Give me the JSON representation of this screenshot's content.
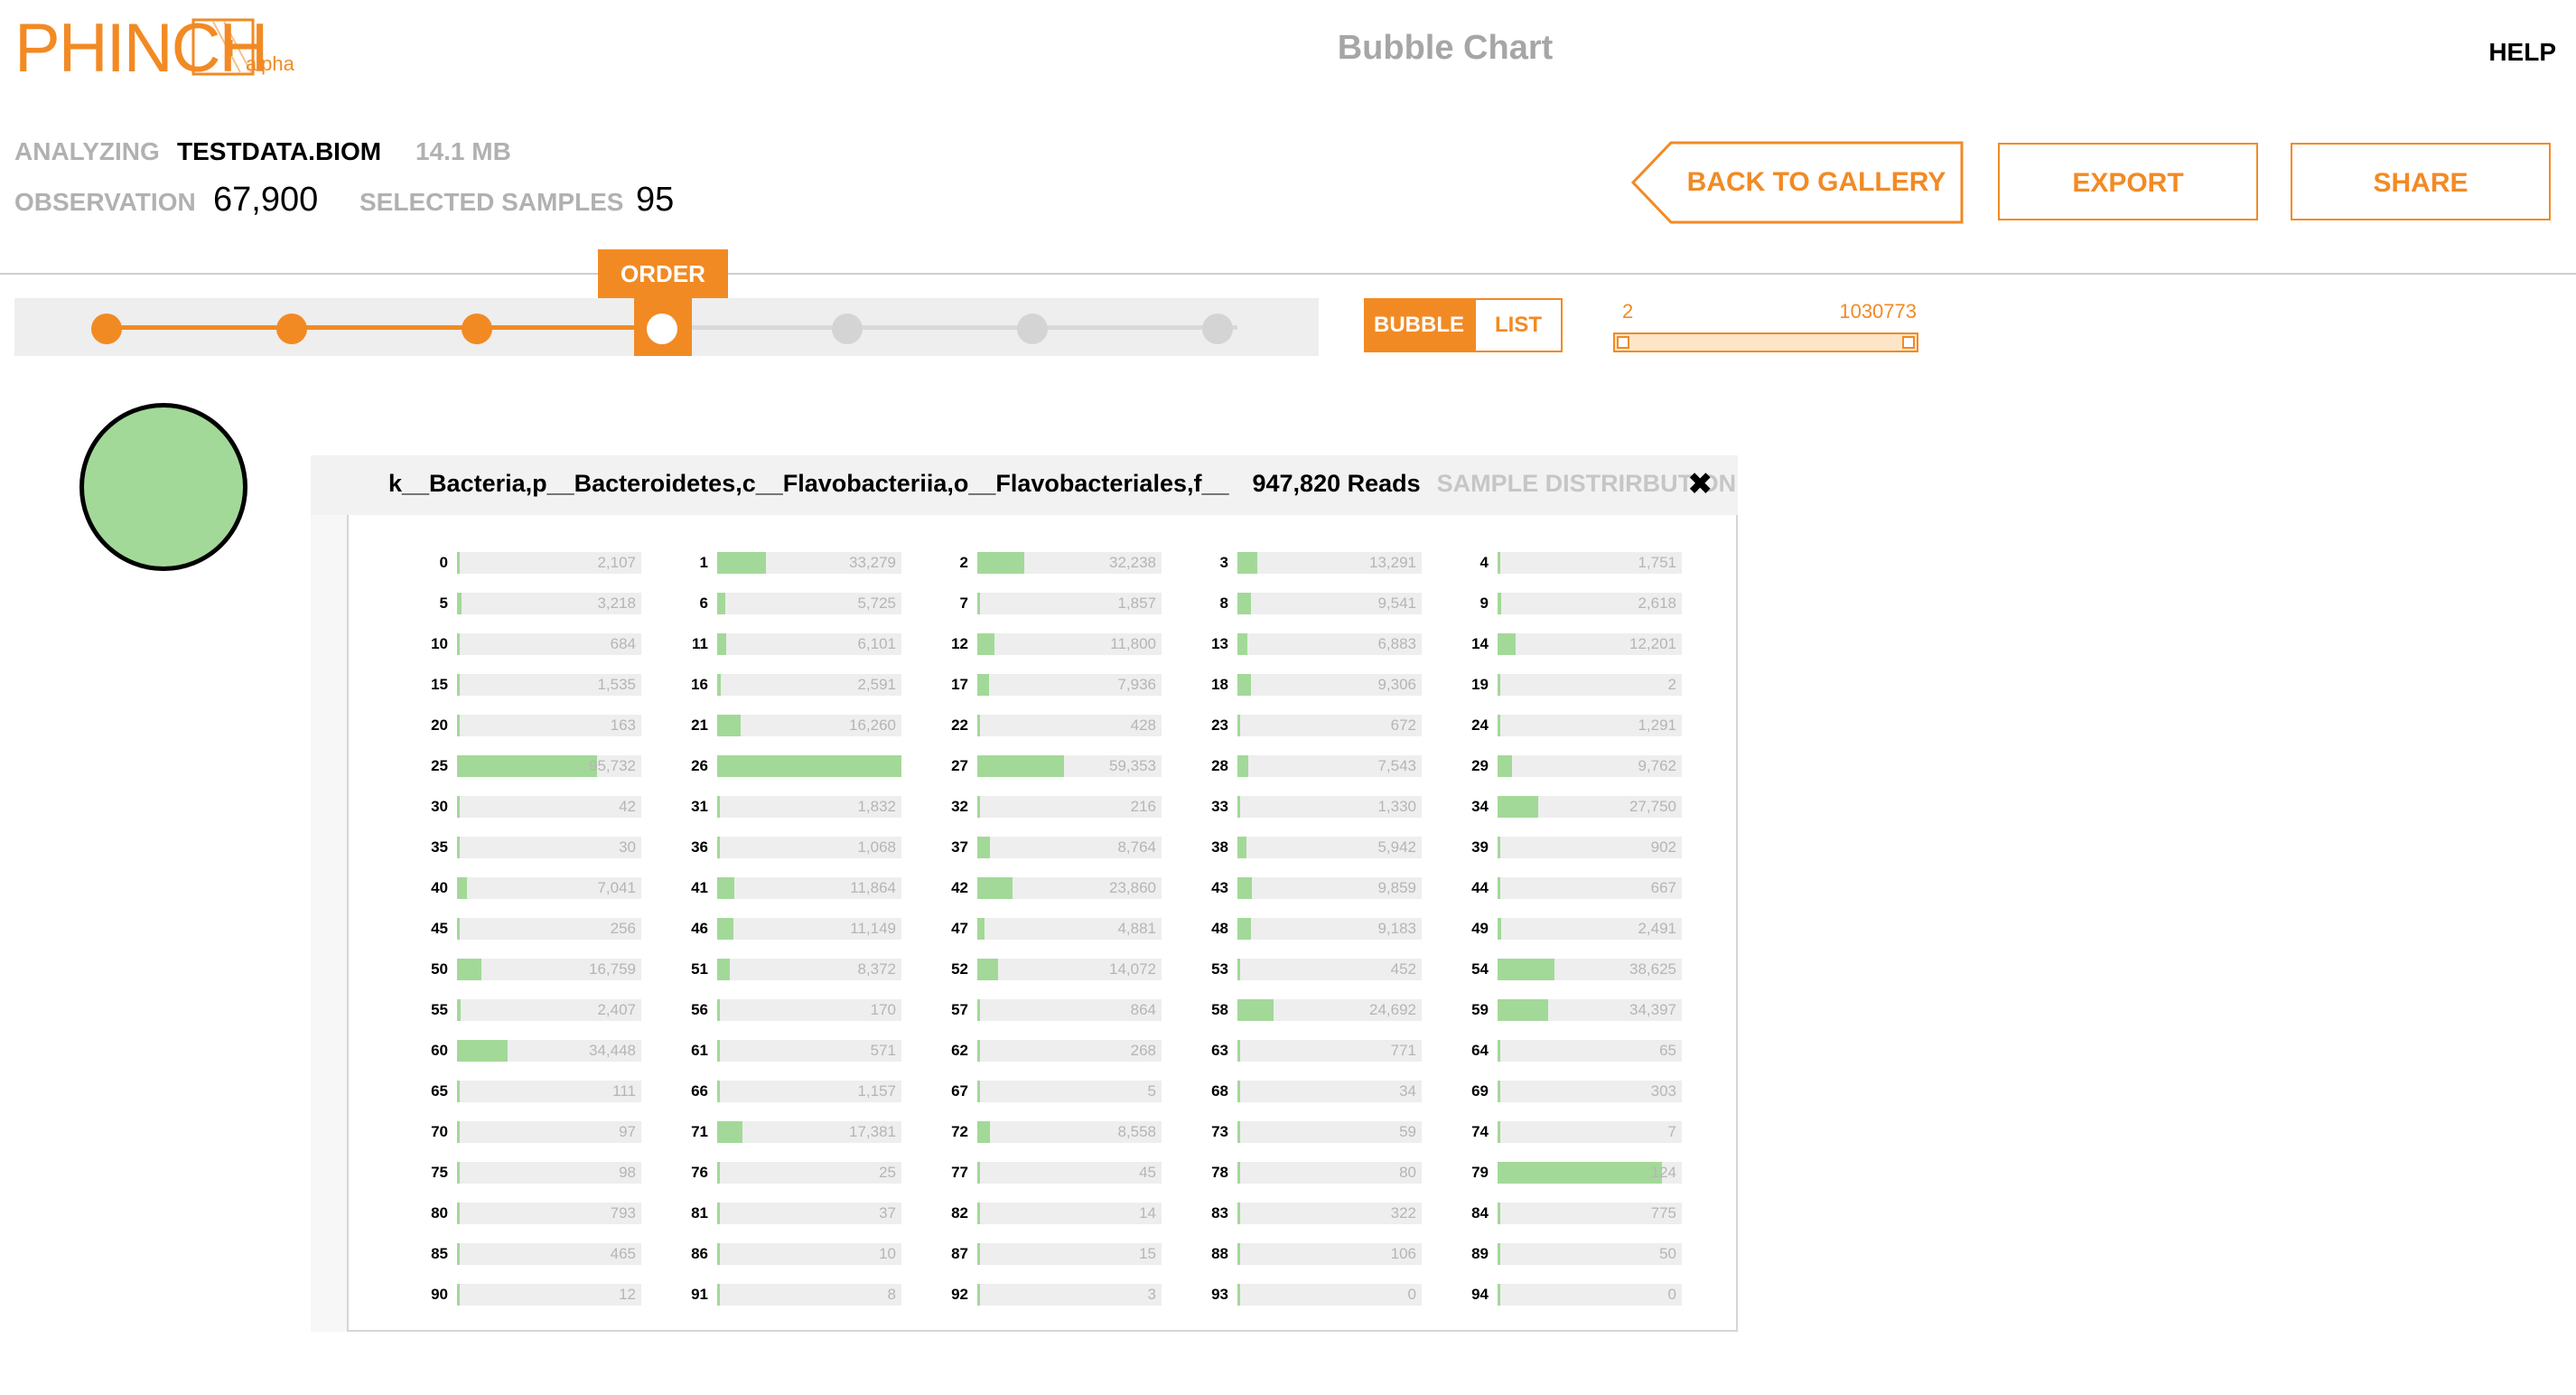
{
  "header": {
    "logo_text": "PHINCH",
    "logo_alpha": "alpha",
    "page_title": "Bubble Chart",
    "help": "HELP"
  },
  "info": {
    "analyzing_label": "ANALYZING",
    "file_name": "TESTDATA.BIOM",
    "file_size": "14.1 MB",
    "observation_label": "OBSERVATION",
    "observation_value": "67,900",
    "selected_samples_label": "SELECTED SAMPLES",
    "selected_samples_value": "95"
  },
  "actions": {
    "back": "BACK TO GALLERY",
    "export": "EXPORT",
    "share": "SHARE"
  },
  "order": {
    "label": "ORDER",
    "level_count": 7,
    "selected_level": 4
  },
  "view_toggle": {
    "bubble": "BUBBLE",
    "list": "LIST",
    "active": "BUBBLE"
  },
  "range": {
    "min": "2",
    "max": "1030773"
  },
  "popup": {
    "taxon": "k__Bacteria,p__Bacteroidetes,c__Flavobacteriia,o__Flavobacteriales,f__",
    "reads": "947,820 Reads",
    "distribution_label": "SAMPLE DISTRIRBUTION",
    "close": "✖",
    "max_value": 126000,
    "samples": [
      {
        "id": "0",
        "value": "2,107"
      },
      {
        "id": "1",
        "value": "33,279"
      },
      {
        "id": "2",
        "value": "32,238"
      },
      {
        "id": "3",
        "value": "13,291"
      },
      {
        "id": "4",
        "value": "1,751"
      },
      {
        "id": "5",
        "value": "3,218"
      },
      {
        "id": "6",
        "value": "5,725"
      },
      {
        "id": "7",
        "value": "1,857"
      },
      {
        "id": "8",
        "value": "9,541"
      },
      {
        "id": "9",
        "value": "2,618"
      },
      {
        "id": "10",
        "value": "684"
      },
      {
        "id": "11",
        "value": "6,101"
      },
      {
        "id": "12",
        "value": "11,800"
      },
      {
        "id": "13",
        "value": "6,883"
      },
      {
        "id": "14",
        "value": "12,201"
      },
      {
        "id": "15",
        "value": "1,535"
      },
      {
        "id": "16",
        "value": "2,591"
      },
      {
        "id": "17",
        "value": "7,936"
      },
      {
        "id": "18",
        "value": "9,306"
      },
      {
        "id": "19",
        "value": "2"
      },
      {
        "id": "20",
        "value": "163"
      },
      {
        "id": "21",
        "value": "16,260"
      },
      {
        "id": "22",
        "value": "428"
      },
      {
        "id": "23",
        "value": "672"
      },
      {
        "id": "24",
        "value": "1,291"
      },
      {
        "id": "25",
        "value": "95,732"
      },
      {
        "id": "26",
        "value": "",
        "fill": "126000"
      },
      {
        "id": "27",
        "value": "59,353"
      },
      {
        "id": "28",
        "value": "7,543"
      },
      {
        "id": "29",
        "value": "9,762"
      },
      {
        "id": "30",
        "value": "42"
      },
      {
        "id": "31",
        "value": "1,832"
      },
      {
        "id": "32",
        "value": "216"
      },
      {
        "id": "33",
        "value": "1,330"
      },
      {
        "id": "34",
        "value": "27,750"
      },
      {
        "id": "35",
        "value": "30"
      },
      {
        "id": "36",
        "value": "1,068"
      },
      {
        "id": "37",
        "value": "8,764"
      },
      {
        "id": "38",
        "value": "5,942"
      },
      {
        "id": "39",
        "value": "902"
      },
      {
        "id": "40",
        "value": "7,041"
      },
      {
        "id": "41",
        "value": "11,864"
      },
      {
        "id": "42",
        "value": "23,860"
      },
      {
        "id": "43",
        "value": "9,859"
      },
      {
        "id": "44",
        "value": "667"
      },
      {
        "id": "45",
        "value": "256"
      },
      {
        "id": "46",
        "value": "11,149"
      },
      {
        "id": "47",
        "value": "4,881"
      },
      {
        "id": "48",
        "value": "9,183"
      },
      {
        "id": "49",
        "value": "2,491"
      },
      {
        "id": "50",
        "value": "16,759"
      },
      {
        "id": "51",
        "value": "8,372"
      },
      {
        "id": "52",
        "value": "14,072"
      },
      {
        "id": "53",
        "value": "452"
      },
      {
        "id": "54",
        "value": "38,625"
      },
      {
        "id": "55",
        "value": "2,407"
      },
      {
        "id": "56",
        "value": "170"
      },
      {
        "id": "57",
        "value": "864"
      },
      {
        "id": "58",
        "value": "24,692"
      },
      {
        "id": "59",
        "value": "34,397"
      },
      {
        "id": "60",
        "value": "34,448"
      },
      {
        "id": "61",
        "value": "571"
      },
      {
        "id": "62",
        "value": "268"
      },
      {
        "id": "63",
        "value": "771"
      },
      {
        "id": "64",
        "value": "65"
      },
      {
        "id": "65",
        "value": "111"
      },
      {
        "id": "66",
        "value": "1,157"
      },
      {
        "id": "67",
        "value": "5"
      },
      {
        "id": "68",
        "value": "34"
      },
      {
        "id": "69",
        "value": "303"
      },
      {
        "id": "70",
        "value": "97"
      },
      {
        "id": "71",
        "value": "17,381"
      },
      {
        "id": "72",
        "value": "8,558"
      },
      {
        "id": "73",
        "value": "59"
      },
      {
        "id": "74",
        "value": "7"
      },
      {
        "id": "75",
        "value": "98"
      },
      {
        "id": "76",
        "value": "25"
      },
      {
        "id": "77",
        "value": "45"
      },
      {
        "id": "78",
        "value": "80"
      },
      {
        "id": "79",
        "value": "124",
        "fill": "112124"
      },
      {
        "id": "80",
        "value": "793"
      },
      {
        "id": "81",
        "value": "37"
      },
      {
        "id": "82",
        "value": "14"
      },
      {
        "id": "83",
        "value": "322"
      },
      {
        "id": "84",
        "value": "775"
      },
      {
        "id": "85",
        "value": "465"
      },
      {
        "id": "86",
        "value": "10"
      },
      {
        "id": "87",
        "value": "15"
      },
      {
        "id": "88",
        "value": "106"
      },
      {
        "id": "89",
        "value": "50"
      },
      {
        "id": "90",
        "value": "12"
      },
      {
        "id": "91",
        "value": "8"
      },
      {
        "id": "92",
        "value": "3"
      },
      {
        "id": "93",
        "value": "0"
      },
      {
        "id": "94",
        "value": "0"
      }
    ]
  },
  "colors": {
    "accent": "#f28a24",
    "bubble_fill": "#a2d998",
    "bar_fill": "#a2d998",
    "bar_bg": "#eeeeee",
    "muted_text": "#b1b1b1"
  }
}
